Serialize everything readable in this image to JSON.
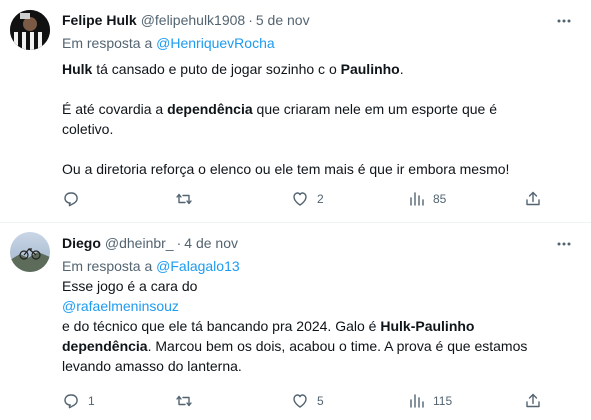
{
  "tweets": [
    {
      "author_name": "Felipe Hulk",
      "author_handle": "@felipehulk1908",
      "separator": "·",
      "date": "5 de nov",
      "reply_prefix": "Em resposta a",
      "reply_to": "@HenriquevRocha",
      "text": {
        "l1_b1": "Hulk",
        "l1_t1": " tá cansado e puto de jogar sozinho c o ",
        "l1_b2": "Paulinho",
        "l1_t2": ".",
        "l2_t1": "É até covardia a ",
        "l2_b1": "dependência",
        "l2_t2": " que criaram nele em um esporte que é",
        "l3_t1": "coletivo.",
        "l4_t1": "Ou a diretoria reforça o elenco ou ele tem mais é que ir embora mesmo!"
      },
      "stats": {
        "replies": "",
        "retweets": "",
        "likes": "2",
        "views": "85"
      }
    },
    {
      "author_name": "Diego",
      "author_handle": "@dheinbr_",
      "separator": "·",
      "date": "4 de nov",
      "reply_prefix": "Em resposta a",
      "reply_to": "@Falagalo13",
      "text": {
        "l1_t1": "Esse jogo é a cara do",
        "l2_mention": "@rafaelmeninsouz",
        "l3_t1": "e do técnico que ele tá bancando pra 2024. Galo é ",
        "l3_b1": "Hulk-Paulinho",
        "l4_b1": "dependência",
        "l4_t1": ". Marcou bem os dois, acabou o time. A prova é que estamos",
        "l5_t1": "levando amasso do lanterna."
      },
      "stats": {
        "replies": "1",
        "retweets": "",
        "likes": "5",
        "views": "115"
      }
    }
  ],
  "icons": {
    "more": "more-horizontal-icon",
    "reply": "reply-icon",
    "retweet": "retweet-icon",
    "like": "heart-icon",
    "views": "views-chart-icon",
    "share": "share-icon"
  },
  "colors": {
    "text": "#0f1419",
    "secondary": "#536471",
    "link": "#1d9bf0",
    "divider": "#eff3f4"
  }
}
